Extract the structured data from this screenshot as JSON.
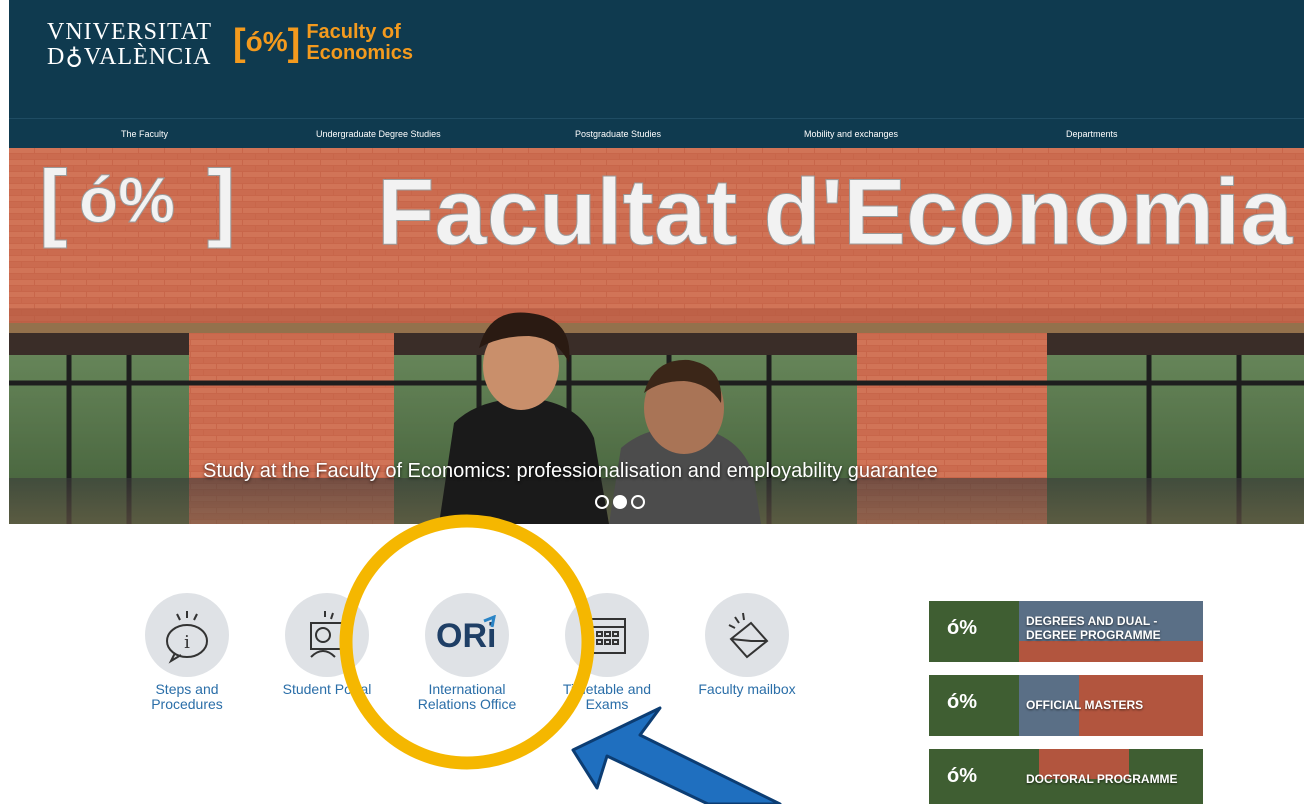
{
  "header": {
    "university_line1": "VNIVERSITAT",
    "university_line2": "D VALÈNCIA",
    "faculty_mark": "[ %]",
    "faculty_line1": "Faculty of",
    "faculty_line2": "Economics"
  },
  "nav": {
    "items": [
      "The Faculty",
      "Undergraduate Degree Studies",
      "Postgraduate Studies",
      "Mobility and exchanges",
      "Departments"
    ]
  },
  "hero": {
    "sign_text": "Facultat d'Economia",
    "caption": "Study at the Faculty of Economics: professionalisation and employability guarantee",
    "slides": 3,
    "active_slide": 2
  },
  "quicklinks": [
    {
      "label": "Steps and Procedures",
      "icon": "info-bubble-icon"
    },
    {
      "label": "Student Portal",
      "icon": "student-portal-icon"
    },
    {
      "label": "International Relations Office",
      "icon": "ori-logo-icon"
    },
    {
      "label": "Timetable and Exams",
      "icon": "calendar-icon"
    },
    {
      "label": "Faculty mailbox",
      "icon": "envelope-icon"
    }
  ],
  "banners": [
    {
      "label": "DEGREES AND DUAL - DEGREE PROGRAMME",
      "line1": "DEGREES AND DUAL -",
      "line2": "DEGREE PROGRAMME"
    },
    {
      "label": "OFFICIAL MASTERS",
      "line1": "OFFICIAL MASTERS",
      "line2": ""
    },
    {
      "label": "DOCTORAL PROGRAMME",
      "line1": "DOCTORAL PROGRAMME",
      "line2": ""
    }
  ],
  "colors": {
    "header_bg": "#0f3a4f",
    "brand_orange": "#f39a1e",
    "link_blue": "#2a6ea8",
    "annotation_circle": "#f5b700",
    "annotation_arrow": "#1f6fbf"
  }
}
